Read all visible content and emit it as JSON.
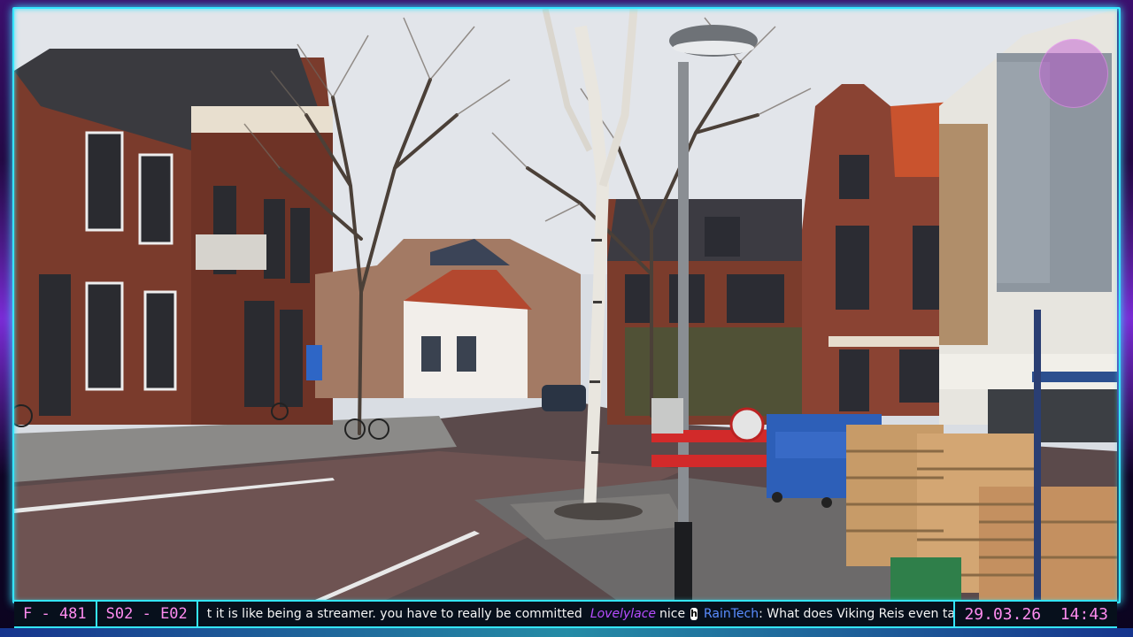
{
  "overlay": {
    "counter_label": "F - 481",
    "episode_label": "S02 - E02",
    "chat": [
      {
        "text": "t it is like being a streamer. you have to really be committed"
      },
      {
        "user": "Lovelylace",
        "text": "nice"
      },
      {
        "user": "RainTech",
        "text": ": What does Viking Reis even taste like?"
      }
    ],
    "clock": "29.03.26  14:43"
  },
  "colors": {
    "frame_border": "#35e6ff",
    "accent_text": "#ff8cf0",
    "user_lovelylace": "#b74dff",
    "user_raintech": "#5a8dff"
  },
  "icons": [
    "yellow-user-badge-icon",
    "h-badge-icon",
    "purple-user-badge-icon",
    "fox-emoji-icon"
  ]
}
